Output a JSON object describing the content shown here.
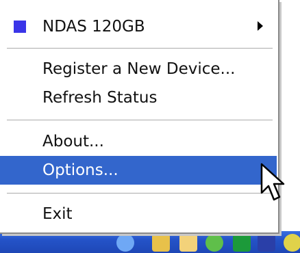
{
  "menu": {
    "device": {
      "label": "NDAS 120GB",
      "status_color": "#3a35e8"
    },
    "register_label": "Register a New Device...",
    "refresh_label": "Refresh Status",
    "about_label": "About...",
    "options_label": "Options...",
    "exit_label": "Exit",
    "highlighted_item": "Options...",
    "highlight_color": "#3366cc"
  },
  "taskbar": {
    "color": "#2453c8",
    "tray_icons": [
      "network-icon",
      "folder-icon",
      "mail-icon",
      "globe-icon",
      "shield-icon",
      "app-icon"
    ]
  }
}
